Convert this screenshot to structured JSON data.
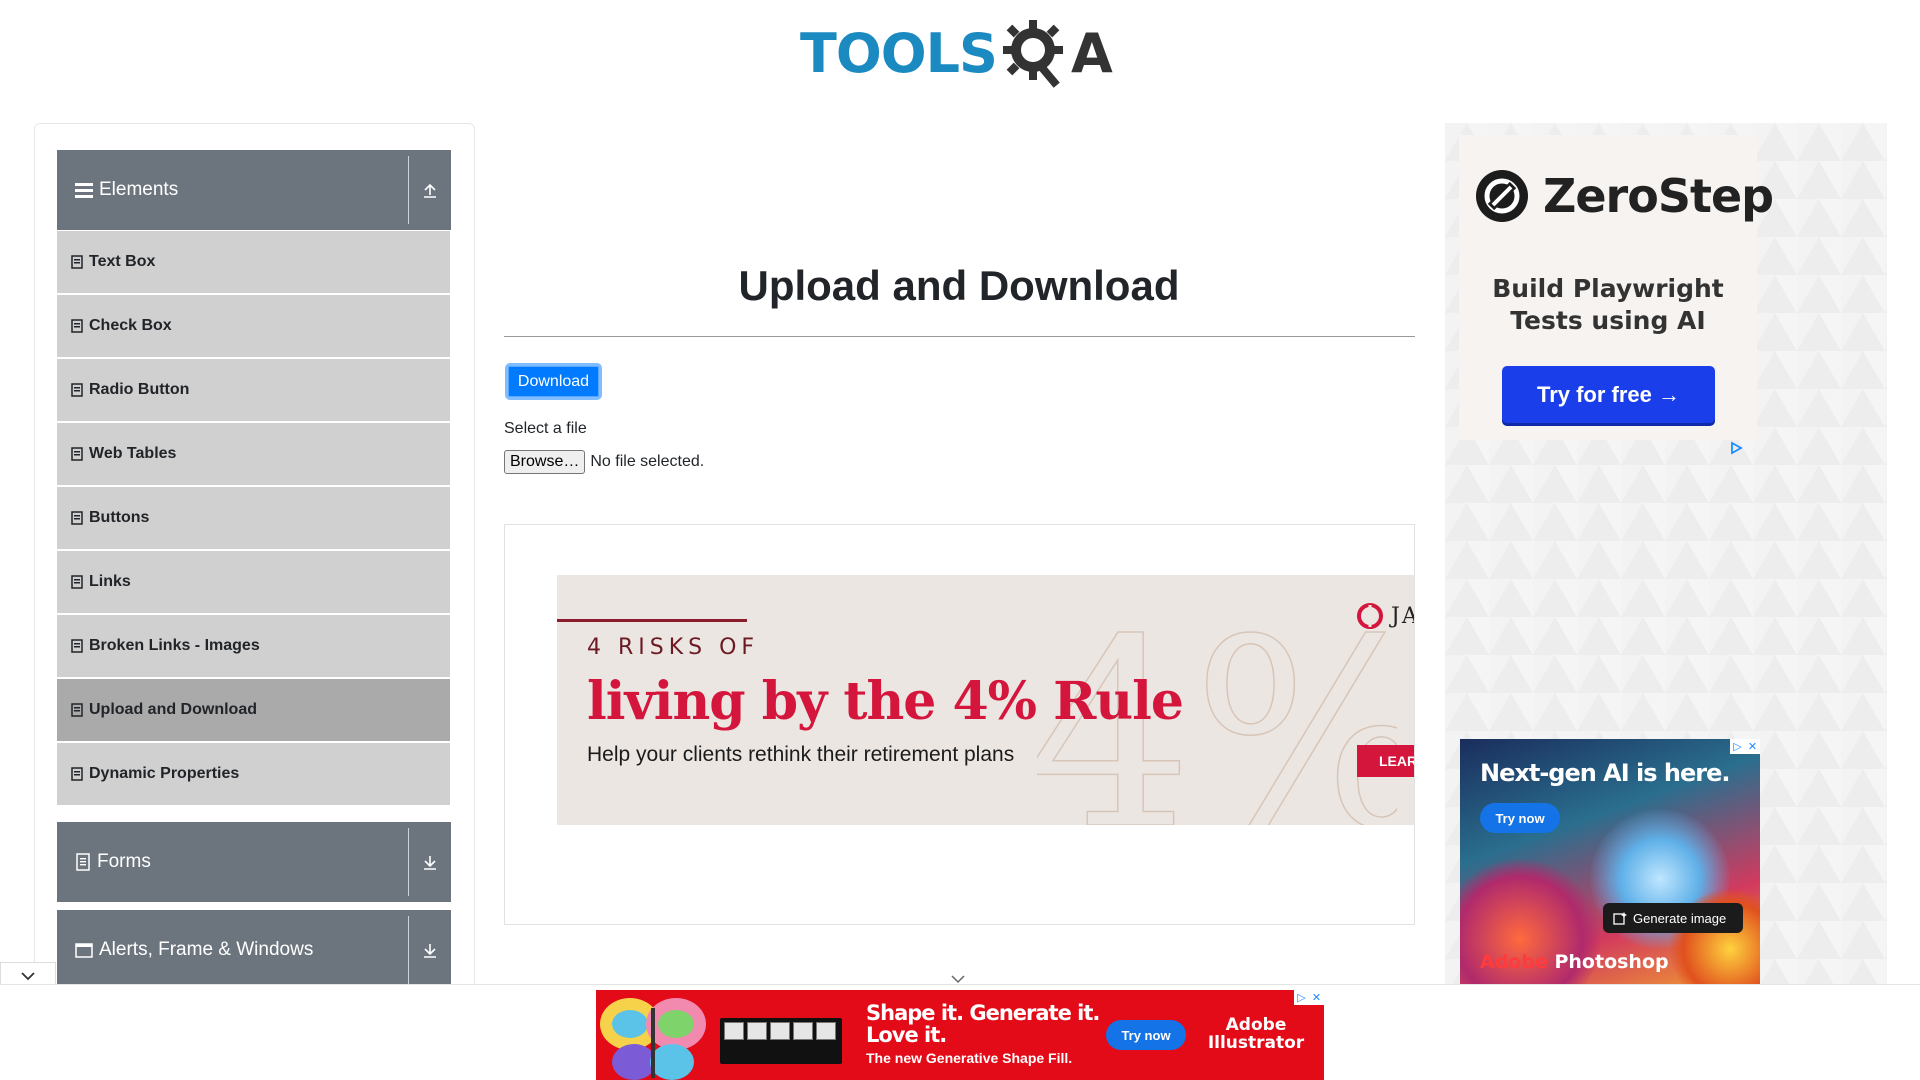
{
  "header": {
    "logo_text": "TOOLS",
    "logo_letter": "A"
  },
  "sidebar": {
    "groups": [
      {
        "label": "Elements",
        "expanded": true,
        "items": [
          {
            "label": "Text Box"
          },
          {
            "label": "Check Box"
          },
          {
            "label": "Radio Button"
          },
          {
            "label": "Web Tables"
          },
          {
            "label": "Buttons"
          },
          {
            "label": "Links"
          },
          {
            "label": "Broken Links - Images"
          },
          {
            "label": "Upload and Download",
            "active": true
          },
          {
            "label": "Dynamic Properties"
          }
        ]
      },
      {
        "label": "Forms",
        "expanded": false
      },
      {
        "label": "Alerts, Frame & Windows",
        "expanded": false
      }
    ]
  },
  "main": {
    "title": "Upload and Download",
    "download_button": "Download",
    "select_label": "Select a file",
    "browse_button": "Browse…",
    "file_status": "No file selected."
  },
  "ads": {
    "banner": {
      "kicker": "4 RISKS OF",
      "headline": "living by the 4% Rule",
      "subtext": "Help your clients rethink their retirement plans",
      "brand": "JACK",
      "cta": "LEARN MO"
    },
    "zerostep": {
      "brand": "ZeroStep",
      "tagline_line1": "Build Playwright",
      "tagline_line2": "Tests using AI",
      "cta": "Try for free →"
    },
    "photoshop": {
      "headline": "Next-gen AI is here.",
      "cta": "Try now",
      "feature": "Generate image",
      "brand_prefix": "Adobe",
      "brand_product": "Photoshop"
    },
    "illustrator": {
      "headline_line1": "Shape it. Generate it.",
      "headline_line2": "Love it.",
      "subtext": "The new Generative Shape Fill.",
      "cta": "Try now",
      "brand_line1": "Adobe",
      "brand_line2": "Illustrator"
    }
  },
  "colors": {
    "sidebar_header": "#6c757d",
    "sidebar_item": "#d0d0d0",
    "sidebar_item_active": "#aaaaaa",
    "primary": "#007bff",
    "logo_blue": "#1b8ac0"
  }
}
